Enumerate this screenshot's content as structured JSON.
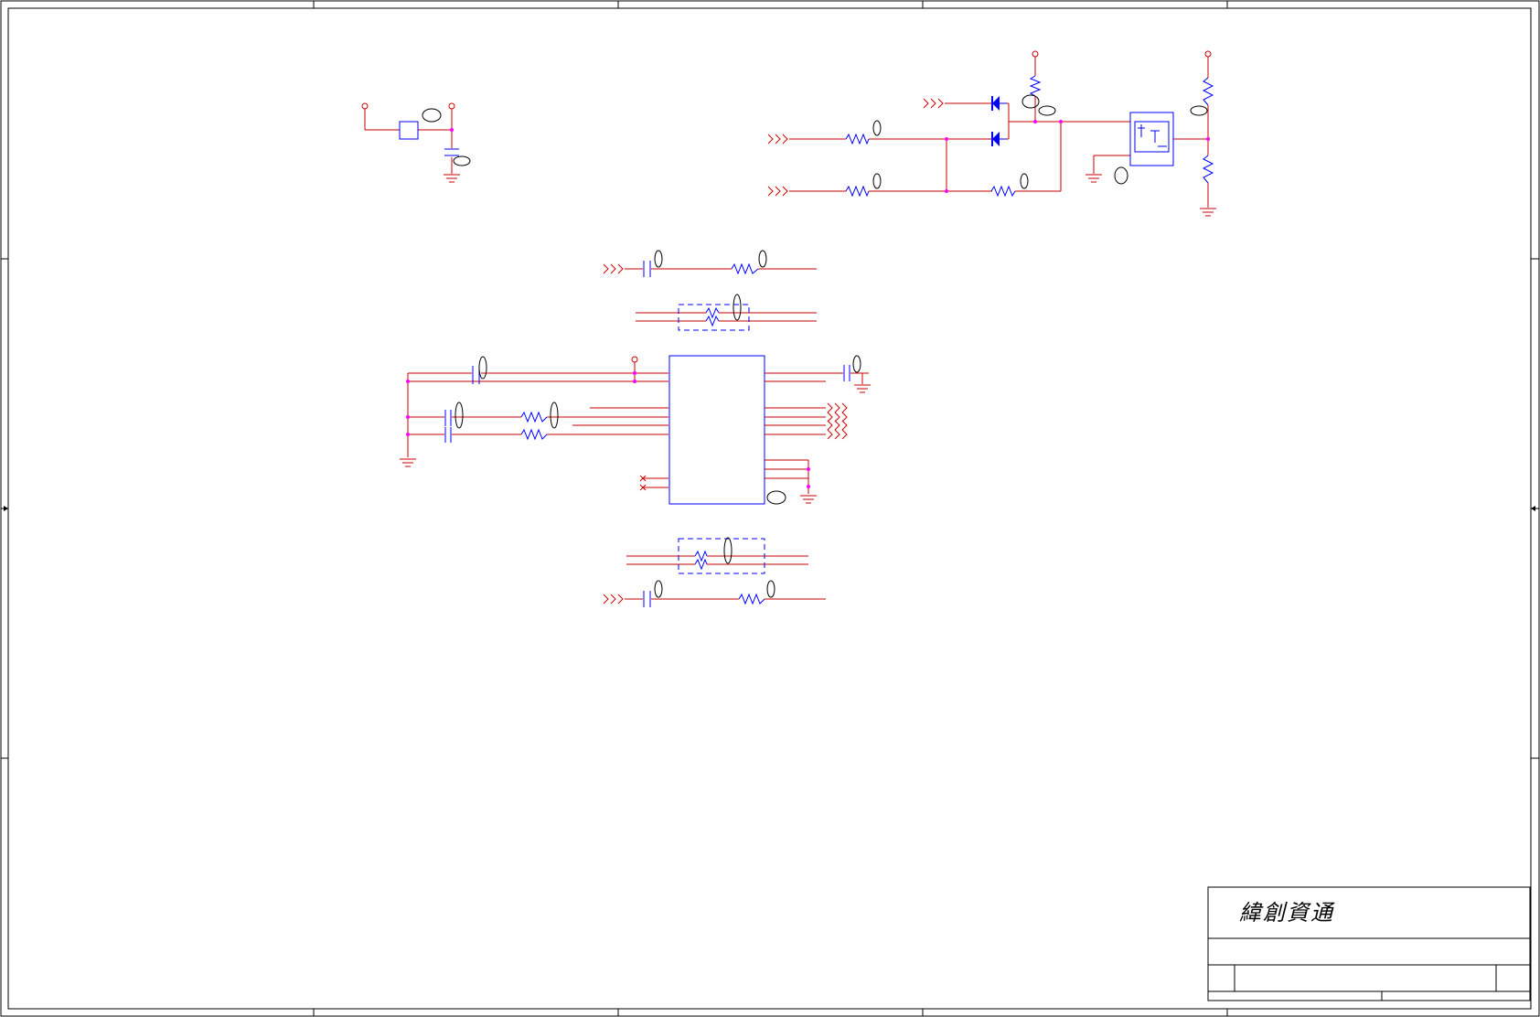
{
  "sheet": {
    "company_name": "緯創資通"
  },
  "colors": {
    "wire": "#cc0000",
    "component": "#0000ff",
    "junction": "#ff00ff",
    "frame": "#000000",
    "background": "#ffffff"
  },
  "icons": {
    "resistor": "resistor-zigzag-symbol",
    "capacitor": "capacitor-symbol",
    "diode": "diode-symbol",
    "ground": "ground-symbol",
    "power_port": "power-port-circle",
    "off_page_connector": "off-page-arrow-connector",
    "no_connect": "no-connect-cross"
  }
}
